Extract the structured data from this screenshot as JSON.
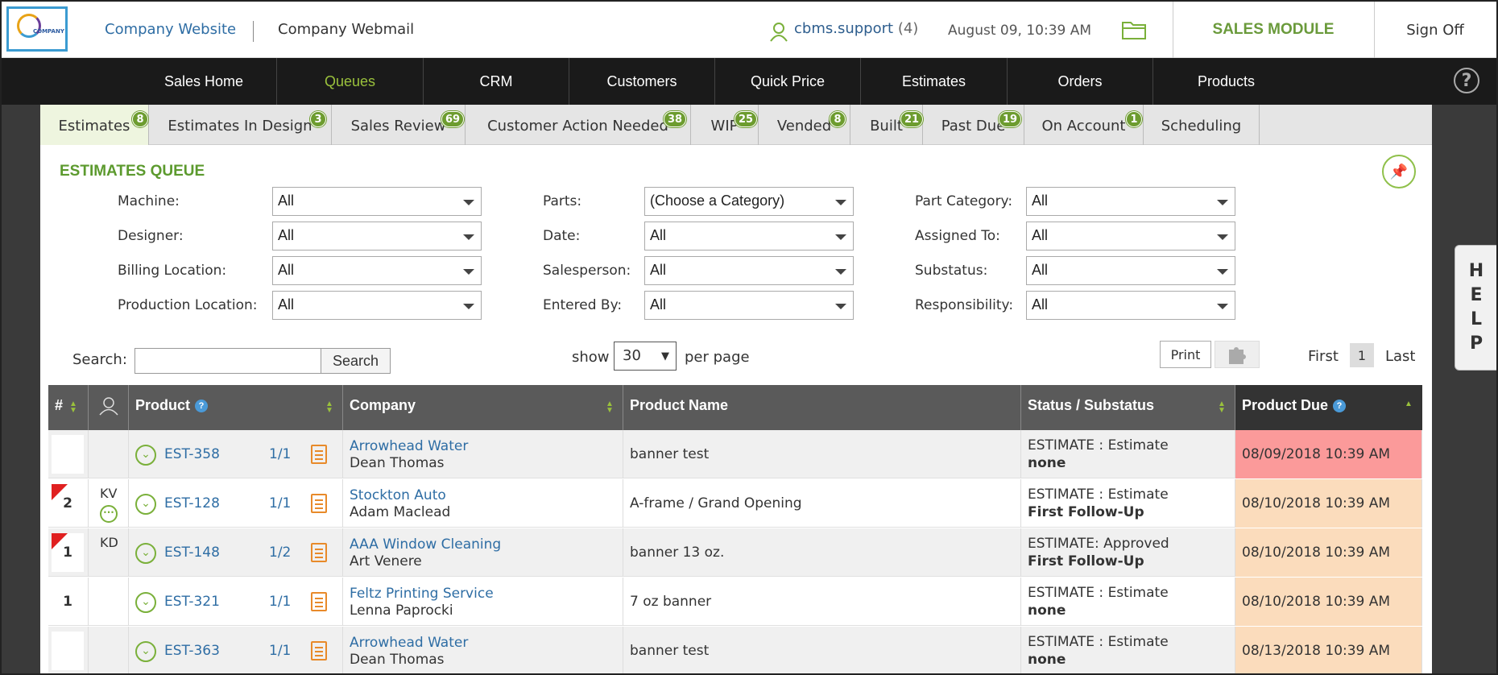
{
  "header": {
    "logo_text": "COMPANY",
    "website_link": "Company Website",
    "webmail_link": "Company Webmail",
    "user": "cbms.support",
    "user_count": "(4)",
    "datetime": "August 09, 10:39 AM",
    "module": "SALES MODULE",
    "signoff": "Sign Off"
  },
  "nav": [
    "Sales Home",
    "Queues",
    "CRM",
    "Customers",
    "Quick Price",
    "Estimates",
    "Orders",
    "Products"
  ],
  "tabs": [
    {
      "label": "Estimates",
      "badge": "8"
    },
    {
      "label": "Estimates In Design",
      "badge": "3"
    },
    {
      "label": "Sales Review",
      "badge": "69"
    },
    {
      "label": "Customer Action Needed",
      "badge": "38"
    },
    {
      "label": "WIP",
      "badge": "25"
    },
    {
      "label": "Vended",
      "badge": "8"
    },
    {
      "label": "Built",
      "badge": "21"
    },
    {
      "label": "Past Due",
      "badge": "19"
    },
    {
      "label": "On Account",
      "badge": "1"
    },
    {
      "label": "Scheduling",
      "badge": ""
    }
  ],
  "queue_title": "ESTIMATES QUEUE",
  "filters": {
    "machine": {
      "label": "Machine:",
      "value": "All"
    },
    "designer": {
      "label": "Designer:",
      "value": "All"
    },
    "billing": {
      "label": "Billing Location:",
      "value": "All"
    },
    "production": {
      "label": "Production Location:",
      "value": "All"
    },
    "parts": {
      "label": "Parts:",
      "value": "(Choose a Category)"
    },
    "date": {
      "label": "Date:",
      "value": "All"
    },
    "salesperson": {
      "label": "Salesperson:",
      "value": "All"
    },
    "enteredby": {
      "label": "Entered By:",
      "value": "All"
    },
    "partcat": {
      "label": "Part Category:",
      "value": "All"
    },
    "assigned": {
      "label": "Assigned To:",
      "value": "All"
    },
    "substatus": {
      "label": "Substatus:",
      "value": "All"
    },
    "responsibility": {
      "label": "Responsibility:",
      "value": "All"
    }
  },
  "search": {
    "label": "Search:",
    "button": "Search",
    "value": ""
  },
  "paging": {
    "show": "show",
    "per_page_value": "30",
    "per_page": "per page",
    "print": "Print",
    "first": "First",
    "page": "1",
    "last": "Last"
  },
  "columns": {
    "num": "#",
    "product": "Product",
    "company": "Company",
    "product_name": "Product Name",
    "status": "Status / Substatus",
    "due": "Product Due"
  },
  "rows": [
    {
      "num": "",
      "flag": false,
      "initials": "",
      "dots": false,
      "est": "EST-358",
      "frac": "1/1",
      "company": "Arrowhead Water",
      "contact": "Dean Thomas",
      "pname": "banner test",
      "status": "ESTIMATE : Estimate",
      "sub": "none",
      "due": "08/09/2018 10:39 AM",
      "due_color": "#fb9a9a"
    },
    {
      "num": "2",
      "flag": true,
      "initials": "KV",
      "dots": true,
      "est": "EST-128",
      "frac": "1/1",
      "company": "Stockton Auto",
      "contact": "Adam Maclead",
      "pname": "A-frame / Grand Opening",
      "status": "ESTIMATE : Estimate",
      "sub": "First Follow-Up",
      "due": "08/10/2018 10:39 AM",
      "due_color": "#fbdcbc"
    },
    {
      "num": "1",
      "flag": true,
      "initials": "KD",
      "dots": false,
      "est": "EST-148",
      "frac": "1/2",
      "company": "AAA Window Cleaning",
      "contact": "Art Venere",
      "pname": "banner 13 oz.",
      "status": "ESTIMATE: Approved",
      "sub": "First Follow-Up",
      "due": "08/10/2018 10:39 AM",
      "due_color": "#fbdcbc"
    },
    {
      "num": "1",
      "flag": false,
      "initials": "",
      "dots": false,
      "est": "EST-321",
      "frac": "1/1",
      "company": "Feltz Printing Service",
      "contact": "Lenna Paprocki",
      "pname": "7 oz banner",
      "status": "ESTIMATE : Estimate",
      "sub": "none",
      "due": "08/10/2018 10:39 AM",
      "due_color": "#fbdcbc"
    },
    {
      "num": "",
      "flag": false,
      "initials": "",
      "dots": false,
      "est": "EST-363",
      "frac": "1/1",
      "company": "Arrowhead Water",
      "contact": "Dean Thomas",
      "pname": "banner test",
      "status": "ESTIMATE : Estimate",
      "sub": "none",
      "due": "08/13/2018 10:39 AM",
      "due_color": "#fbdcbc"
    }
  ],
  "help_side": [
    "H",
    "E",
    "L",
    "P"
  ]
}
